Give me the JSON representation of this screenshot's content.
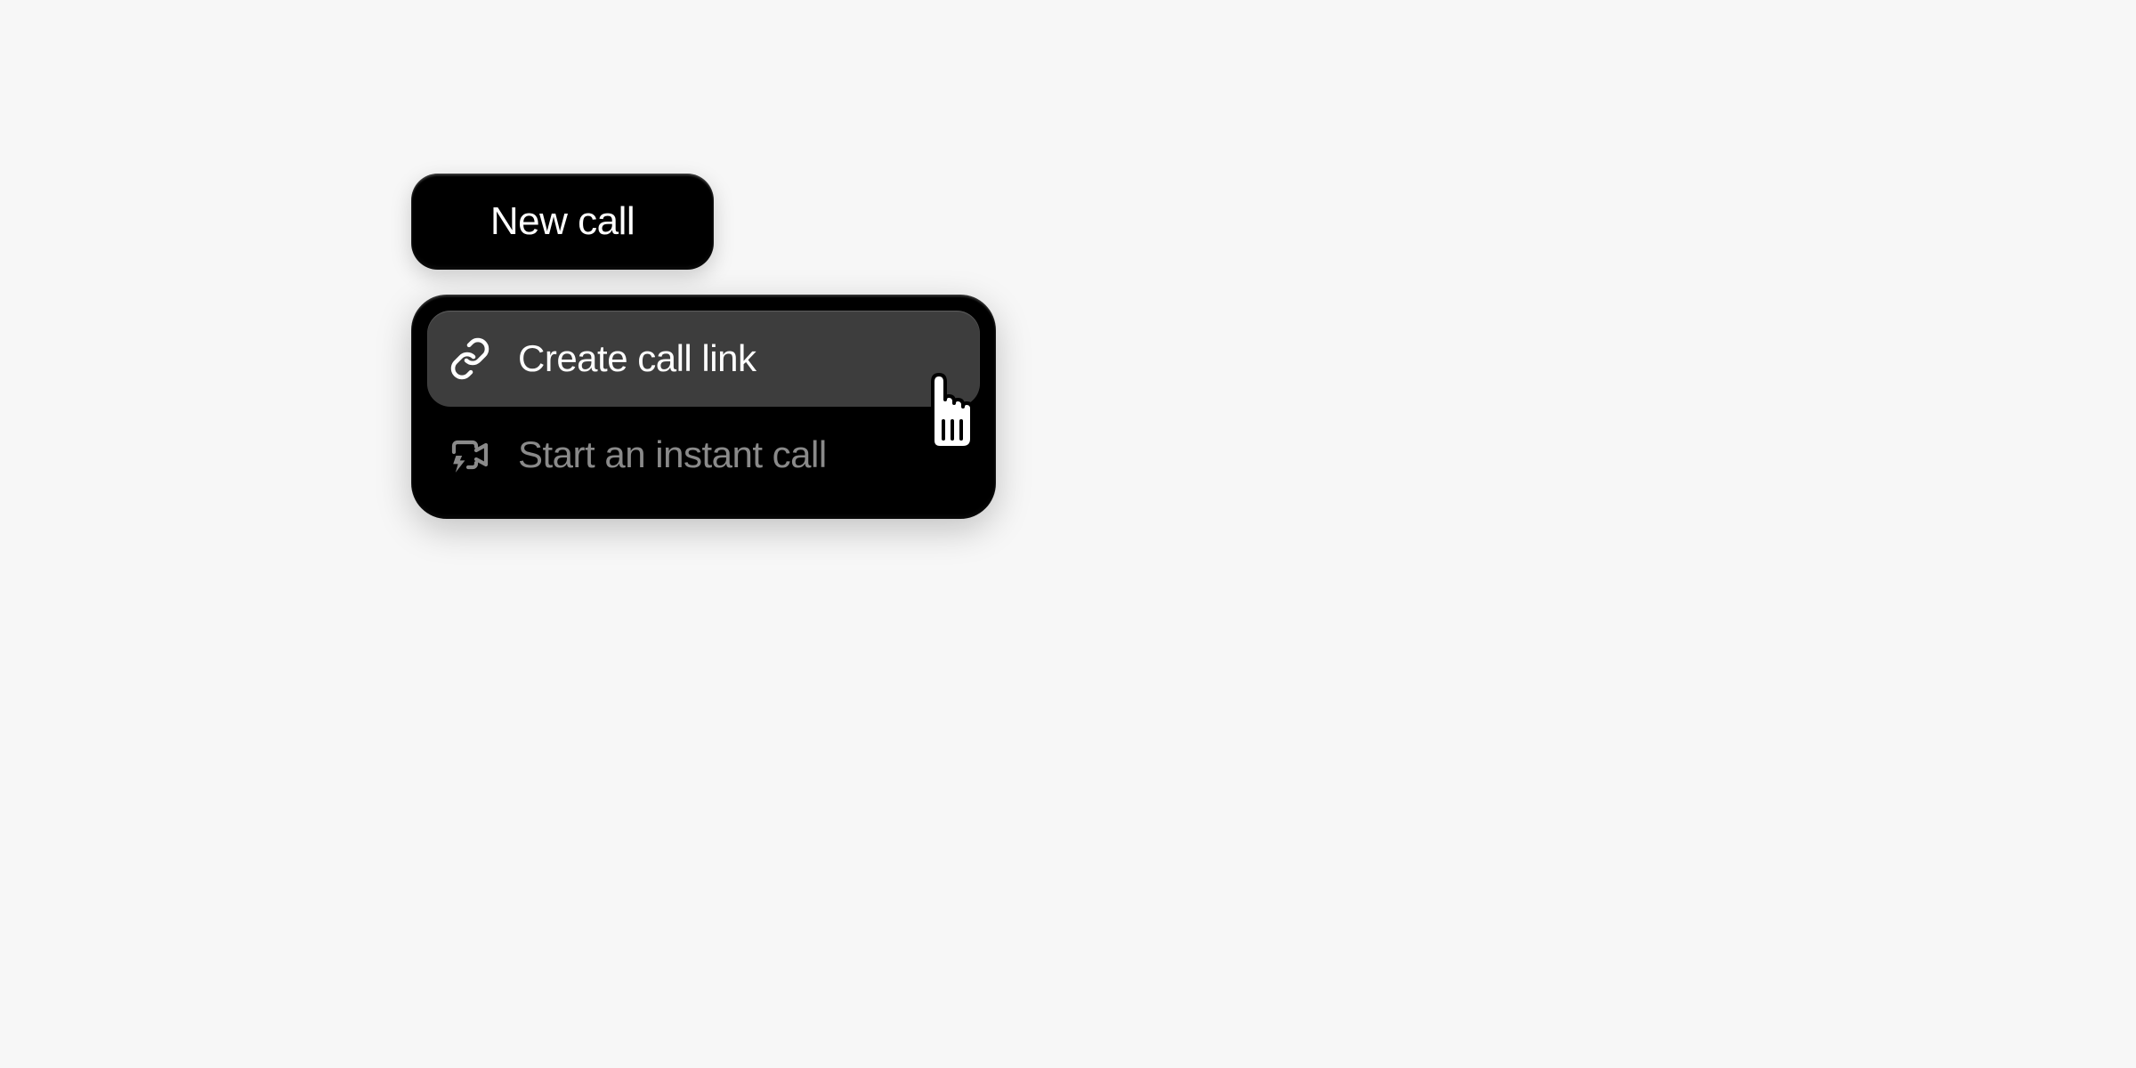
{
  "button": {
    "label": "New call"
  },
  "menu": {
    "items": [
      {
        "label": "Create call link",
        "icon": "link-icon",
        "highlighted": true
      },
      {
        "label": "Start an instant call",
        "icon": "video-instant-icon",
        "highlighted": false
      }
    ]
  }
}
